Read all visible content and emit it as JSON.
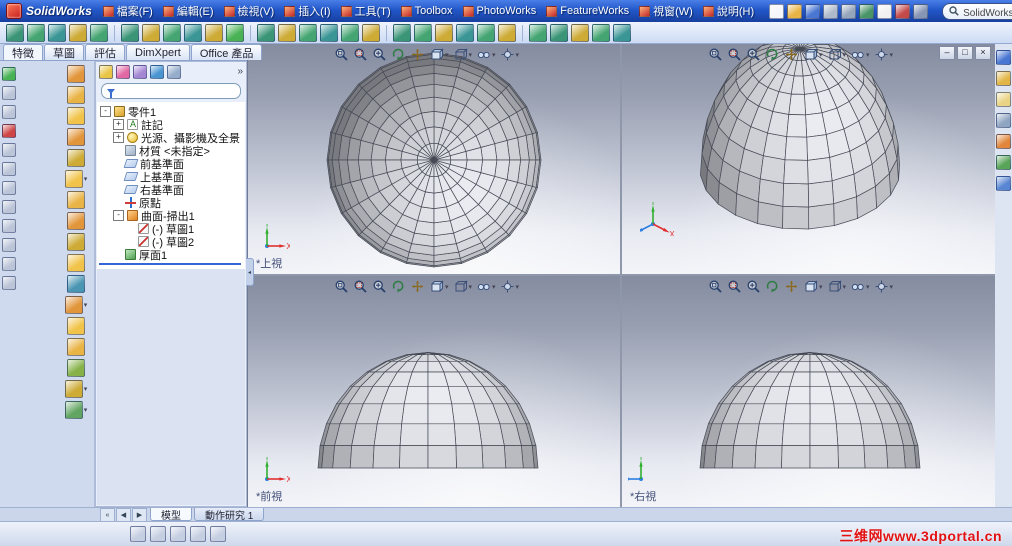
{
  "titlebar": {
    "logo_text": "SolidWorks",
    "menus": [
      {
        "name": "file",
        "label": "檔案(F)"
      },
      {
        "name": "edit",
        "label": "編輯(E)"
      },
      {
        "name": "view",
        "label": "檢視(V)"
      },
      {
        "name": "insert",
        "label": "插入(I)"
      },
      {
        "name": "tools",
        "label": "工具(T)"
      },
      {
        "name": "toolbox",
        "label": "Toolbox"
      },
      {
        "name": "photoworks",
        "label": "PhotoWorks"
      },
      {
        "name": "featureworks",
        "label": "FeatureWorks"
      },
      {
        "name": "window",
        "label": "視窗(W)"
      },
      {
        "name": "help",
        "label": "說明(H)"
      }
    ],
    "quick_icons": [
      {
        "name": "new-document",
        "color": "#f4f6fa"
      },
      {
        "name": "open-document",
        "color": "#e8b03c"
      },
      {
        "name": "save",
        "color": "#3f6fd0"
      },
      {
        "name": "print",
        "color": "#aab6c8"
      },
      {
        "name": "print-preview",
        "color": "#8fa0b8"
      },
      {
        "name": "undo",
        "color": "#3f8f5f"
      },
      {
        "name": "select-pointer",
        "color": "#f0f0f0"
      },
      {
        "name": "rebuild",
        "color": "#c04040"
      },
      {
        "name": "options",
        "color": "#7f8fb0"
      }
    ],
    "search_value": "SolidWorks 搜尋",
    "search_chevron": "▾",
    "help_label": "?"
  },
  "main_toolbar": {
    "separators_before": [
      5,
      11,
      17,
      23
    ],
    "icons": [
      {
        "name": "new",
        "color": "#2f8f6f"
      },
      {
        "name": "open",
        "color": "#3aa06a"
      },
      {
        "name": "save",
        "color": "#2f8f8f"
      },
      {
        "name": "print",
        "color": "#caa62a"
      },
      {
        "name": "print-preview",
        "color": "#3aa06a"
      },
      {
        "name": "undo",
        "color": "#2f8f6f"
      },
      {
        "name": "redo",
        "color": "#caa62a"
      },
      {
        "name": "cut",
        "color": "#3aa06a"
      },
      {
        "name": "copy",
        "color": "#2f8f8f"
      },
      {
        "name": "paste",
        "color": "#caa62a"
      },
      {
        "name": "rebuild",
        "color": "#3fae4c"
      },
      {
        "name": "options",
        "color": "#2f8f6f"
      },
      {
        "name": "select",
        "color": "#caa62a"
      },
      {
        "name": "sketch",
        "color": "#3aa06a"
      },
      {
        "name": "smart-dimension",
        "color": "#2f8f8f"
      },
      {
        "name": "line",
        "color": "#3aa06a"
      },
      {
        "name": "circle",
        "color": "#caa62a"
      },
      {
        "name": "arc",
        "color": "#2f8f6f"
      },
      {
        "name": "spline",
        "color": "#3aa06a"
      },
      {
        "name": "trim",
        "color": "#caa62a"
      },
      {
        "name": "extrude-boss",
        "color": "#2f8f8f"
      },
      {
        "name": "extrude-cut",
        "color": "#3aa06a"
      },
      {
        "name": "revolve",
        "color": "#caa62a"
      },
      {
        "name": "swept-boss",
        "color": "#3aa06a"
      },
      {
        "name": "lofted-boss",
        "color": "#2f8f6f"
      },
      {
        "name": "fillet",
        "color": "#caa62a"
      },
      {
        "name": "chamfer",
        "color": "#3aa06a"
      },
      {
        "name": "shell",
        "color": "#2f8f8f"
      }
    ]
  },
  "manager_tabs": [
    {
      "name": "features",
      "label": "特徵",
      "active": true
    },
    {
      "name": "sketch",
      "label": "草圖",
      "active": false
    },
    {
      "name": "evaluate",
      "label": "評估",
      "active": false
    },
    {
      "name": "dimxpert",
      "label": "DimXpert",
      "active": false
    },
    {
      "name": "office-products",
      "label": "Office 產品",
      "active": false
    }
  ],
  "left_toolbar_a": [
    {
      "name": "play",
      "color": "#3fae4c"
    },
    {
      "name": "stop",
      "color": "#b8c2d6"
    },
    {
      "name": "frame",
      "color": "#b8c2d6"
    },
    {
      "name": "record",
      "color": "#cc3b3b"
    },
    {
      "name": "table",
      "color": "#b8c2d6"
    },
    {
      "name": "panel",
      "color": "#b8c2d6"
    },
    {
      "name": "layers",
      "color": "#b8c2d6"
    },
    {
      "name": "grid",
      "color": "#b8c2d6"
    },
    {
      "name": "list",
      "color": "#b8c2d6"
    },
    {
      "name": "box",
      "color": "#b8c2d6"
    },
    {
      "name": "chart",
      "color": "#b8c2d6"
    },
    {
      "name": "note",
      "color": "#b8c2d6"
    }
  ],
  "left_toolbar_b": [
    {
      "name": "extrude",
      "color": "#e09030"
    },
    {
      "name": "revolve",
      "color": "#e8b03c"
    },
    {
      "name": "sweep",
      "color": "#f0c040"
    },
    {
      "name": "loft",
      "color": "#e09030"
    },
    {
      "name": "boundary",
      "color": "#caa62a"
    },
    {
      "name": "fillet",
      "color": "#f0c040",
      "chevron": true
    },
    {
      "name": "chamfer",
      "color": "#e8b03c"
    },
    {
      "name": "shell",
      "color": "#e09030"
    },
    {
      "name": "rib",
      "color": "#caa62a"
    },
    {
      "name": "draft",
      "color": "#f0c040"
    },
    {
      "name": "hole-wizard",
      "color": "#3f8fae"
    },
    {
      "name": "pattern",
      "color": "#e09030",
      "chevron": true
    },
    {
      "name": "mirror",
      "color": "#f0c040"
    },
    {
      "name": "dome",
      "color": "#e8b03c"
    },
    {
      "name": "wrap",
      "color": "#7fae3f"
    },
    {
      "name": "reference-geometry",
      "color": "#caa62a",
      "chevron": true
    },
    {
      "name": "curve",
      "color": "#5aa05a",
      "chevron": true
    }
  ],
  "feature_panel": {
    "header_icons": [
      {
        "name": "featuremanager-design-tree",
        "color": "#e8c23c"
      },
      {
        "name": "propertymanager",
        "color": "#e060a0"
      },
      {
        "name": "configurationmanager",
        "color": "#9f7fd0"
      },
      {
        "name": "dimxpertmanager",
        "color": "#3f8fd0"
      },
      {
        "name": "display-pane",
        "color": "#8fa8c8"
      }
    ],
    "overflow_label": "»",
    "tree": {
      "root": {
        "name": "part1",
        "label": "零件1",
        "icon": "part",
        "expander": "-",
        "depth": 0
      },
      "items": [
        {
          "name": "annotations",
          "label": "註記",
          "icon": "annotations",
          "expander": "+",
          "depth": 1
        },
        {
          "name": "lights-cameras-scene",
          "label": "光源、攝影機及全景",
          "icon": "lights",
          "expander": "+",
          "depth": 1
        },
        {
          "name": "material",
          "label": "材質 <未指定>",
          "icon": "material",
          "depth": 1
        },
        {
          "name": "front-plane",
          "label": "前基準面",
          "icon": "plane",
          "depth": 1
        },
        {
          "name": "top-plane",
          "label": "上基準面",
          "icon": "plane",
          "depth": 1
        },
        {
          "name": "right-plane",
          "label": "右基準面",
          "icon": "plane",
          "depth": 1
        },
        {
          "name": "origin",
          "label": "原點",
          "icon": "origin",
          "depth": 1
        },
        {
          "name": "surface-sweep1",
          "label": "曲面-掃出1",
          "icon": "surface-sweep",
          "expander": "-",
          "depth": 1
        },
        {
          "name": "sketch1",
          "label": "(-) 草圖1",
          "icon": "sketch",
          "depth": 2
        },
        {
          "name": "sketch2",
          "label": "(-) 草圖2",
          "icon": "sketch",
          "depth": 2
        },
        {
          "name": "thicken1",
          "label": "厚面1",
          "icon": "thicken",
          "depth": 1
        }
      ]
    }
  },
  "viewports": {
    "chevron_glyph": "▾",
    "toolbar_icons": [
      {
        "name": "zoom-to-fit"
      },
      {
        "name": "zoom-to-area"
      },
      {
        "name": "zoom-in-out"
      },
      {
        "name": "rotate-view"
      },
      {
        "name": "pan"
      },
      {
        "name": "standard-views",
        "chevron": true
      },
      {
        "name": "display-style",
        "chevron": true
      },
      {
        "name": "hide-show-items",
        "chevron": true
      },
      {
        "name": "view-settings",
        "chevron": true
      }
    ],
    "panes": [
      {
        "name": "top",
        "label": "*上視"
      },
      {
        "name": "isometric",
        "label": ""
      },
      {
        "name": "front",
        "label": "*前視"
      },
      {
        "name": "right",
        "label": "*右視"
      }
    ],
    "window_controls": [
      {
        "name": "minimize",
        "glyph": "–"
      },
      {
        "name": "restore",
        "glyph": "□"
      },
      {
        "name": "close",
        "glyph": "×"
      }
    ]
  },
  "task_pane": [
    {
      "name": "solidworks-resources",
      "color": "#3f6fd0"
    },
    {
      "name": "design-library",
      "color": "#e0b23c"
    },
    {
      "name": "file-explorer",
      "color": "#e8d27f"
    },
    {
      "name": "search",
      "color": "#8aa0be"
    },
    {
      "name": "view-palette",
      "color": "#e08030"
    },
    {
      "name": "appearances-scenes",
      "color": "#4f9f4f"
    },
    {
      "name": "document-recovery",
      "color": "#4f7fd0"
    }
  ],
  "bottom": {
    "tab_scroll": [
      {
        "name": "scroll-first",
        "glyph": "«"
      },
      {
        "name": "scroll-prev",
        "glyph": "◀"
      },
      {
        "name": "scroll-next",
        "glyph": "▶"
      }
    ],
    "doc_tabs": [
      {
        "name": "model",
        "label": "模型",
        "active": true
      },
      {
        "name": "motion-study-1",
        "label": "動作研究 1",
        "active": false
      }
    ],
    "status_icons": [
      {
        "name": "tree-display"
      },
      {
        "name": "viewport-layout"
      },
      {
        "name": "display-pane"
      },
      {
        "name": "section-view"
      },
      {
        "name": "quick-tips"
      }
    ],
    "watermark": "三维网www.3dportal.cn"
  }
}
